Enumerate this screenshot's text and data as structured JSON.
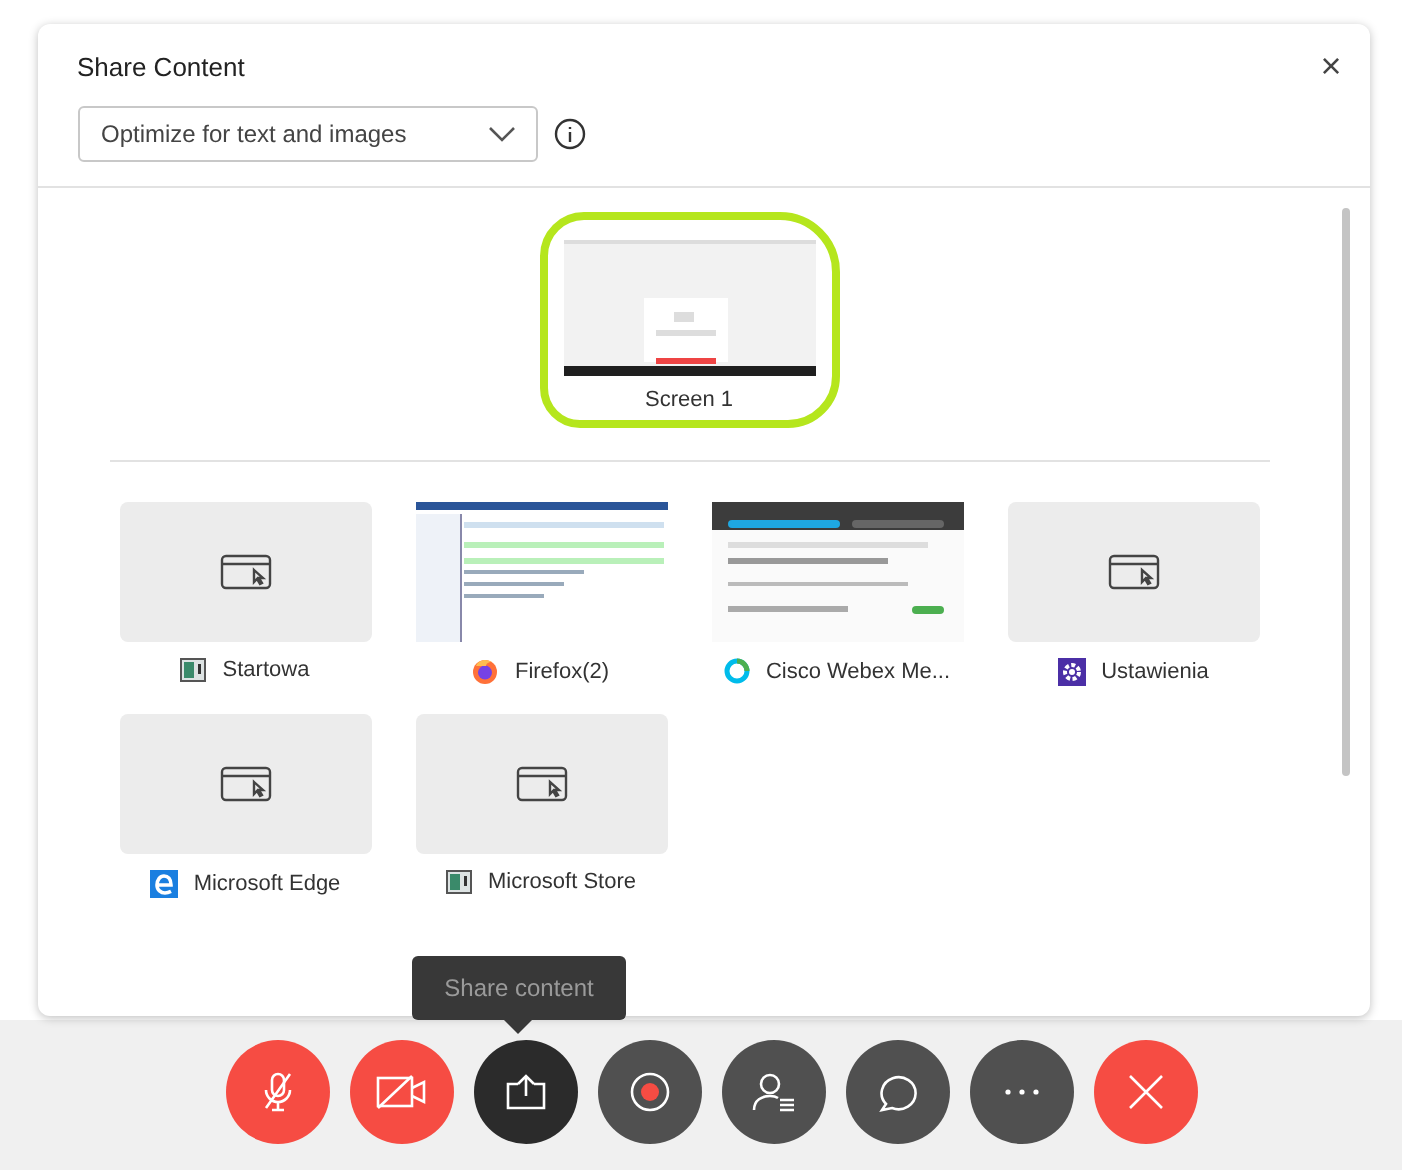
{
  "dialog": {
    "title": "Share Content",
    "close": "×",
    "optimize": {
      "value": "Optimize for text and images"
    },
    "screens": [
      {
        "label": "Screen 1",
        "selected": true
      }
    ],
    "apps": [
      {
        "label": "Startowa",
        "kind": "startowa"
      },
      {
        "label": "Firefox(2)",
        "kind": "firefox"
      },
      {
        "label": "Cisco Webex Me...",
        "kind": "webex"
      },
      {
        "label": "Ustawienia",
        "kind": "settings"
      },
      {
        "label": "Microsoft Edge",
        "kind": "edge"
      },
      {
        "label": "Microsoft Store",
        "kind": "store"
      }
    ]
  },
  "tooltip": "Share content",
  "toolbar": [
    {
      "kind": "mic",
      "color": "#f64c43"
    },
    {
      "kind": "video",
      "color": "#f64c43"
    },
    {
      "kind": "share",
      "color": "#2b2b2b"
    },
    {
      "kind": "record",
      "color": "#505050"
    },
    {
      "kind": "participants",
      "color": "#505050"
    },
    {
      "kind": "chat",
      "color": "#505050"
    },
    {
      "kind": "more",
      "color": "#505050"
    },
    {
      "kind": "leave",
      "color": "#f64c43"
    }
  ]
}
